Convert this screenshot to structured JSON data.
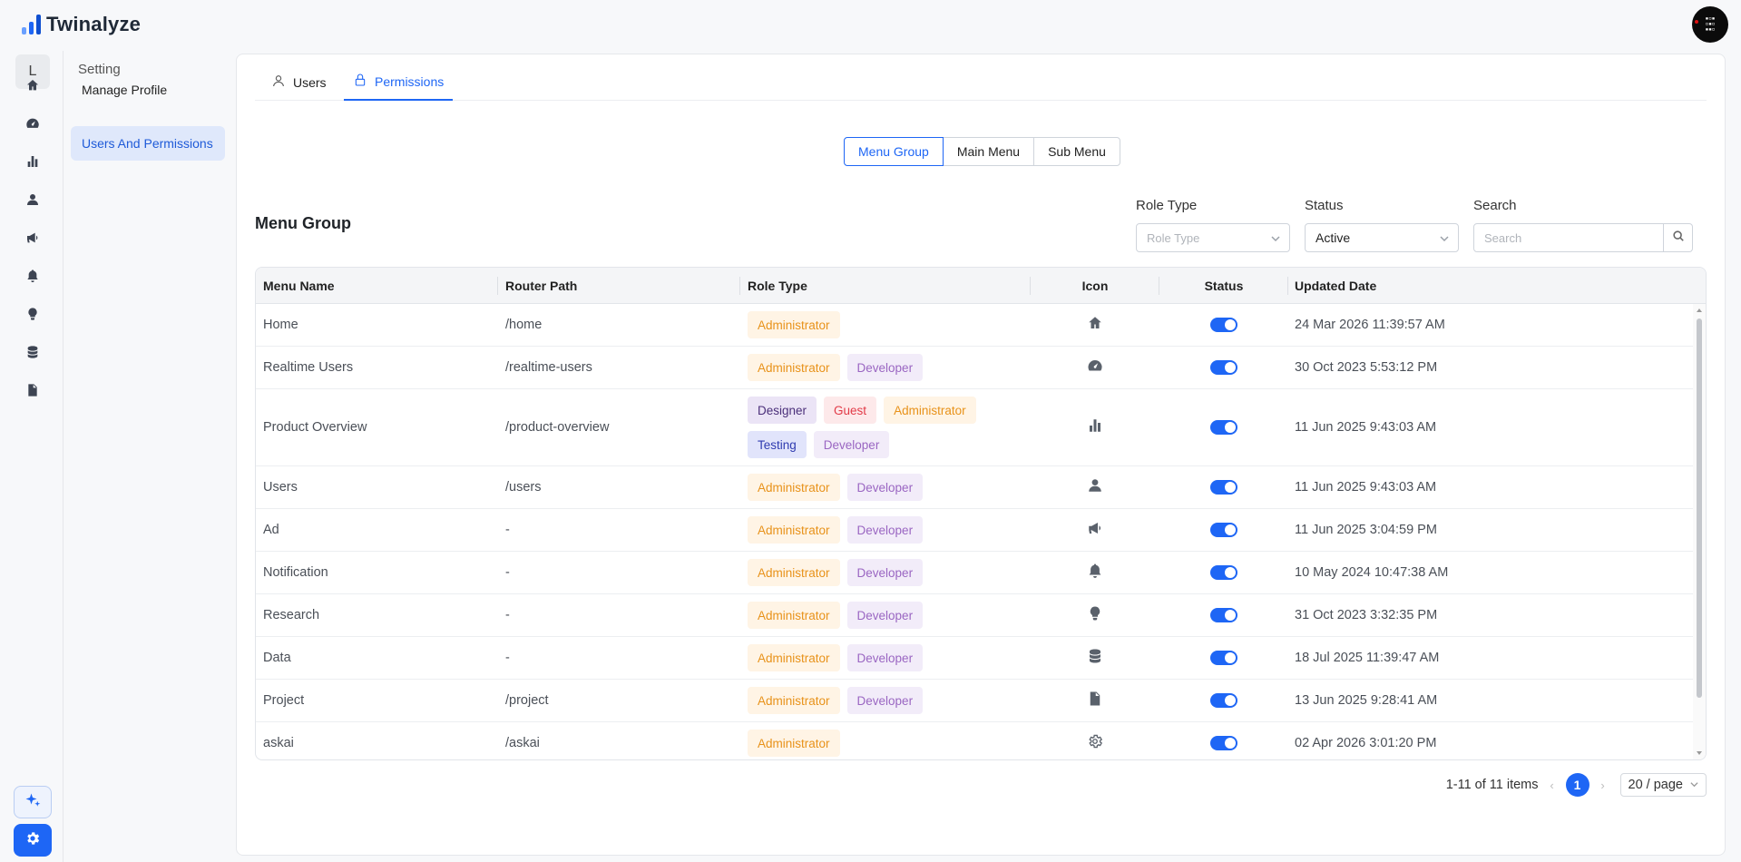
{
  "app": {
    "name": "Twinalyze"
  },
  "avatar": {
    "text": ""
  },
  "rail": {
    "letter": "L",
    "icons": [
      "home-icon",
      "dashboard-icon",
      "bar-chart-icon",
      "user-icon",
      "megaphone-icon",
      "bell-icon",
      "lightbulb-icon",
      "database-icon",
      "file-icon"
    ],
    "bottom": [
      "sparkle-icon",
      "gear-icon"
    ]
  },
  "subnav": {
    "heading": "Setting",
    "items": [
      {
        "label": "Manage Profile",
        "active": false
      },
      {
        "label": "Users And Permissions",
        "active": true
      }
    ]
  },
  "tabs": [
    {
      "label": "Users",
      "icon": "user-icon",
      "active": false
    },
    {
      "label": "Permissions",
      "icon": "lock-icon",
      "active": true
    }
  ],
  "segments": [
    {
      "label": "Menu Group",
      "active": true
    },
    {
      "label": "Main Menu",
      "active": false
    },
    {
      "label": "Sub Menu",
      "active": false
    }
  ],
  "section": {
    "title": "Menu Group"
  },
  "filters": {
    "role_type": {
      "label": "Role Type",
      "placeholder": "Role Type"
    },
    "status": {
      "label": "Status",
      "value": "Active"
    },
    "search": {
      "label": "Search",
      "placeholder": "Search"
    }
  },
  "table": {
    "columns": [
      "Menu Name",
      "Router Path",
      "Role Type",
      "Icon",
      "Status",
      "Updated Date"
    ],
    "rows": [
      {
        "name": "Home",
        "path": "/home",
        "roles": [
          "Administrator"
        ],
        "icon": "home-icon",
        "status": true,
        "updated": "24 Mar 2026 11:39:57 AM"
      },
      {
        "name": "Realtime Users",
        "path": "/realtime-users",
        "roles": [
          "Administrator",
          "Developer"
        ],
        "icon": "dashboard-icon",
        "status": true,
        "updated": "30 Oct 2023 5:53:12 PM"
      },
      {
        "name": "Product Overview",
        "path": "/product-overview",
        "roles": [
          "Designer",
          "Guest",
          "Administrator",
          "Testing",
          "Developer"
        ],
        "icon": "bar-chart-icon",
        "status": true,
        "updated": "11 Jun 2025 9:43:03 AM"
      },
      {
        "name": "Users",
        "path": "/users",
        "roles": [
          "Administrator",
          "Developer"
        ],
        "icon": "user-icon",
        "status": true,
        "updated": "11 Jun 2025 9:43:03 AM"
      },
      {
        "name": "Ad",
        "path": "-",
        "roles": [
          "Administrator",
          "Developer"
        ],
        "icon": "megaphone-icon",
        "status": true,
        "updated": "11 Jun 2025 3:04:59 PM"
      },
      {
        "name": "Notification",
        "path": "-",
        "roles": [
          "Administrator",
          "Developer"
        ],
        "icon": "bell-icon",
        "status": true,
        "updated": "10 May 2024 10:47:38 AM"
      },
      {
        "name": "Research",
        "path": "-",
        "roles": [
          "Administrator",
          "Developer"
        ],
        "icon": "lightbulb-icon",
        "status": true,
        "updated": "31 Oct 2023 3:32:35 PM"
      },
      {
        "name": "Data",
        "path": "-",
        "roles": [
          "Administrator",
          "Developer"
        ],
        "icon": "database-icon",
        "status": true,
        "updated": "18 Jul 2025 11:39:47 AM"
      },
      {
        "name": "Project",
        "path": "/project",
        "roles": [
          "Administrator",
          "Developer"
        ],
        "icon": "file-icon",
        "status": true,
        "updated": "13 Jun 2025 9:28:41 AM"
      },
      {
        "name": "askai",
        "path": "/askai",
        "roles": [
          "Administrator"
        ],
        "icon": "gear-icon",
        "status": true,
        "updated": "02 Apr 2026 3:01:20 PM"
      }
    ]
  },
  "pagination": {
    "range": "1-11 of 11 items",
    "current_page": "1",
    "page_size": "20 / page"
  },
  "colors": {
    "accent": "#1e66f5"
  }
}
